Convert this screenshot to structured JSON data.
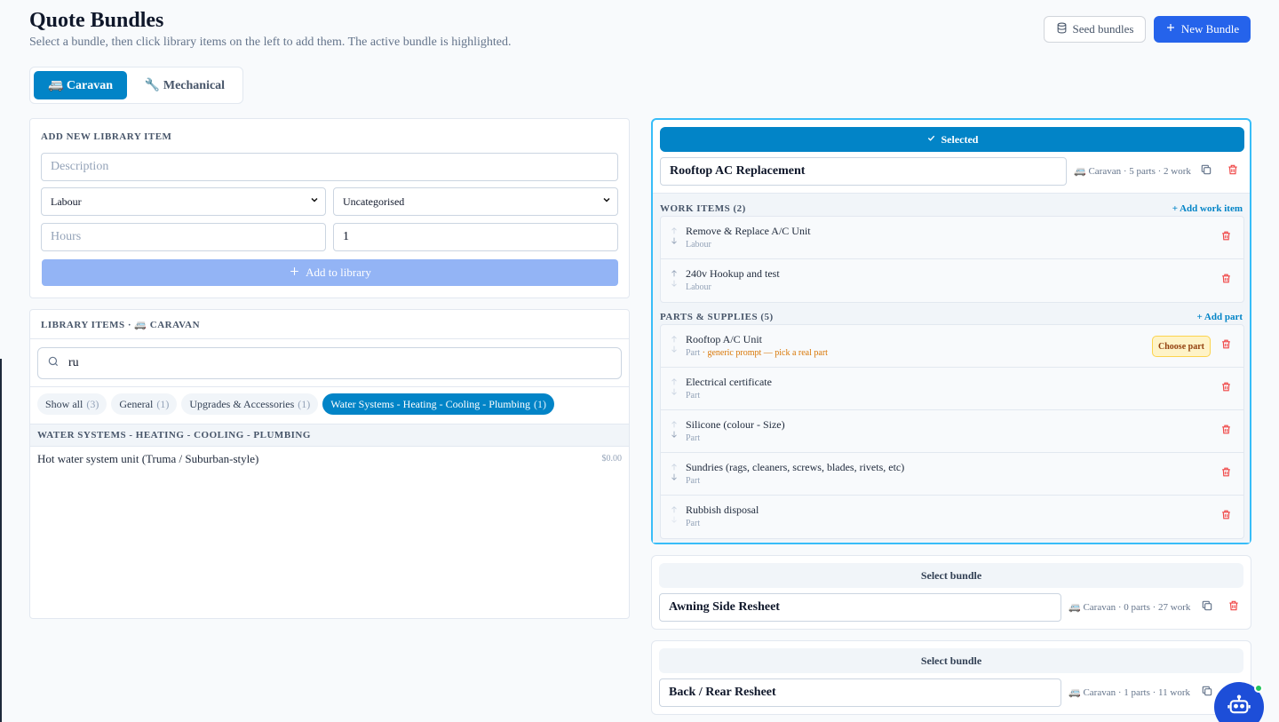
{
  "header": {
    "title": "Quote Bundles",
    "subtitle": "Select a bundle, then click library items on the left to add them. The active bundle is highlighted.",
    "seed_label": "Seed bundles",
    "new_label": "New Bundle"
  },
  "tabs": [
    {
      "label": "🚐 Caravan",
      "active": true
    },
    {
      "label": "🔧 Mechanical",
      "active": false
    }
  ],
  "add_item": {
    "heading": "ADD NEW LIBRARY ITEM",
    "description_placeholder": "Description",
    "type_value": "Labour",
    "category_value": "Uncategorised",
    "hours_placeholder": "Hours",
    "qty_value": "1",
    "add_label": "Add to library"
  },
  "library": {
    "heading": "LIBRARY ITEMS · 🚐 CARAVAN",
    "search_value": "ru",
    "chips": [
      {
        "label": "Show all",
        "count": "(3)"
      },
      {
        "label": "General",
        "count": "(1)"
      },
      {
        "label": "Upgrades & Accessories",
        "count": "(1)"
      },
      {
        "label": "Water Systems - Heating - Cooling - Plumbing",
        "count": "(1)"
      }
    ],
    "group": "WATER SYSTEMS - HEATING - COOLING - PLUMBING",
    "items": [
      {
        "name": "Hot water system unit (Truma / Suburban-style)",
        "price": "$0.00"
      }
    ]
  },
  "bundles": [
    {
      "bar_label": "Selected",
      "name": "Rooftop AC Replacement",
      "meta": "🚐 Caravan · 5 parts · 2 work",
      "work_title": "WORK ITEMS (2)",
      "add_work": "+ Add work item",
      "work_items": [
        {
          "title": "Remove & Replace A/C Unit",
          "type": "Labour"
        },
        {
          "title": "240v Hookup and test",
          "type": "Labour"
        }
      ],
      "parts_title": "PARTS & SUPPLIES (5)",
      "add_part": "+ Add part",
      "parts": [
        {
          "title": "Rooftop A/C Unit",
          "type": "Part",
          "warning": "· generic prompt — pick a real part",
          "action": "Choose part"
        },
        {
          "title": "Electrical certificate",
          "type": "Part"
        },
        {
          "title": "Silicone (colour - Size)",
          "type": "Part"
        },
        {
          "title": "Sundries (rags, cleaners, screws, blades, rivets, etc)",
          "type": "Part"
        },
        {
          "title": "Rubbish disposal",
          "type": "Part"
        }
      ]
    },
    {
      "bar_label": "Select bundle",
      "name": "Awning Side Resheet",
      "meta": "🚐 Caravan · 0 parts · 27 work"
    },
    {
      "bar_label": "Select bundle",
      "name": "Back / Rear Resheet",
      "meta": "🚐 Caravan · 1 parts · 11 work"
    }
  ],
  "colors": {
    "primary": "#2563eb",
    "accent": "#0284c7",
    "selected_border": "#38bdf8",
    "danger": "#ef4444",
    "warning": "#d97706"
  }
}
